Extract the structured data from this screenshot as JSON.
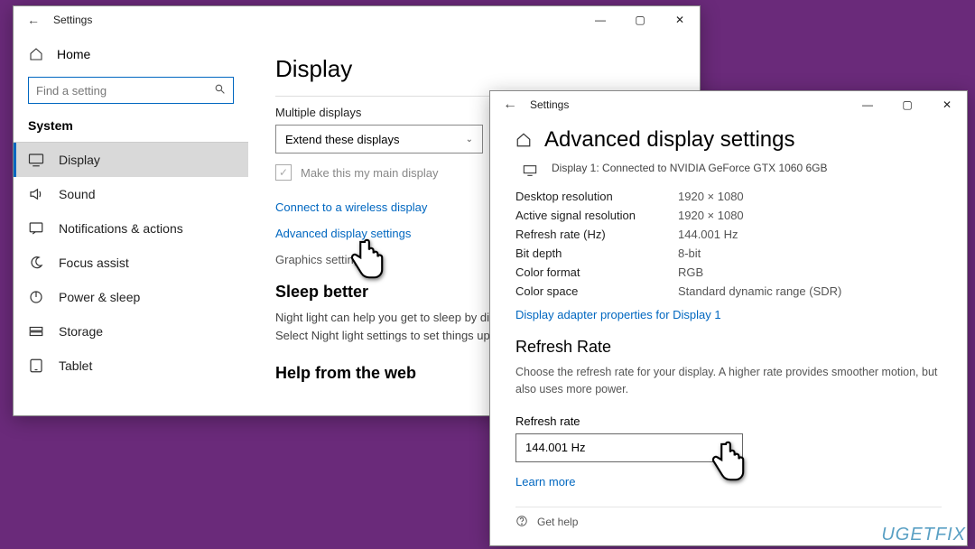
{
  "win1": {
    "title": "Settings",
    "home": "Home",
    "search_placeholder": "Find a setting",
    "section": "System",
    "sidebar": [
      {
        "icon": "display",
        "label": "Display",
        "active": true
      },
      {
        "icon": "sound",
        "label": "Sound"
      },
      {
        "icon": "notify",
        "label": "Notifications & actions"
      },
      {
        "icon": "focus",
        "label": "Focus assist"
      },
      {
        "icon": "power",
        "label": "Power & sleep"
      },
      {
        "icon": "storage",
        "label": "Storage"
      },
      {
        "icon": "tablet",
        "label": "Tablet"
      }
    ],
    "main": {
      "h1": "Display",
      "multi_label": "Multiple displays",
      "multi_value": "Extend these displays",
      "main_display_check": "Make this my main display",
      "connect_wireless": "Connect to a wireless display",
      "adv_link": "Advanced display settings",
      "graphics_link": "Graphics settings",
      "sleep_head": "Sleep better",
      "sleep_body": "Night light can help you get to sleep by displaying warmer colors at night. Select Night light settings to set things up.",
      "help_head": "Help from the web"
    }
  },
  "win2": {
    "title": "Settings",
    "h1": "Advanced display settings",
    "conn": "Display 1: Connected to NVIDIA GeForce GTX 1060 6GB",
    "rows": [
      {
        "k": "Desktop resolution",
        "v": "1920 × 1080"
      },
      {
        "k": "Active signal resolution",
        "v": "1920 × 1080"
      },
      {
        "k": "Refresh rate (Hz)",
        "v": "144.001 Hz"
      },
      {
        "k": "Bit depth",
        "v": "8-bit"
      },
      {
        "k": "Color format",
        "v": "RGB"
      },
      {
        "k": "Color space",
        "v": "Standard dynamic range (SDR)"
      }
    ],
    "adapter_link": "Display adapter properties for Display 1",
    "rr_head": "Refresh Rate",
    "rr_desc": "Choose the refresh rate for your display. A higher rate provides smoother motion, but also uses more power.",
    "rr_label": "Refresh rate",
    "rr_value": "144.001 Hz",
    "learn_more": "Learn more",
    "get_help": "Get help"
  },
  "watermark": "UGETFIX"
}
